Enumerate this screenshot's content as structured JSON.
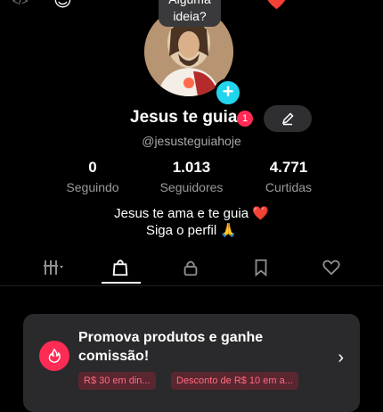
{
  "bubble": {
    "line1": "Alguma",
    "line2": "ideia?"
  },
  "profile": {
    "name": "Jesus te guia",
    "notification_count": "1",
    "handle": "@jesusteguiahoje",
    "edit_icon": "pencil-icon",
    "add_icon": "+"
  },
  "stats": [
    {
      "value": "0",
      "label": "Seguindo"
    },
    {
      "value": "1.013",
      "label": "Seguidores"
    },
    {
      "value": "4.771",
      "label": "Curtidas"
    }
  ],
  "bio": {
    "line1": "Jesus te ama e te guia ❤️",
    "line2": "Siga o perfil 🙏"
  },
  "tabs": [
    {
      "name": "grid-filter",
      "icon": "grid-filter-icon",
      "active": false
    },
    {
      "name": "shop",
      "icon": "shopping-bag-icon",
      "active": true
    },
    {
      "name": "private",
      "icon": "lock-icon",
      "active": false
    },
    {
      "name": "saved",
      "icon": "bookmark-icon",
      "active": false
    },
    {
      "name": "liked",
      "icon": "heart-icon",
      "active": false
    }
  ],
  "promo": {
    "title": "Promova produtos e ganhe comissão!",
    "chips": [
      "R$ 30 em din...",
      "Desconto de R$ 10 em a..."
    ]
  },
  "colors": {
    "accent": "#fe2c55",
    "add_badge": "#20d5ec",
    "background": "#000000"
  }
}
